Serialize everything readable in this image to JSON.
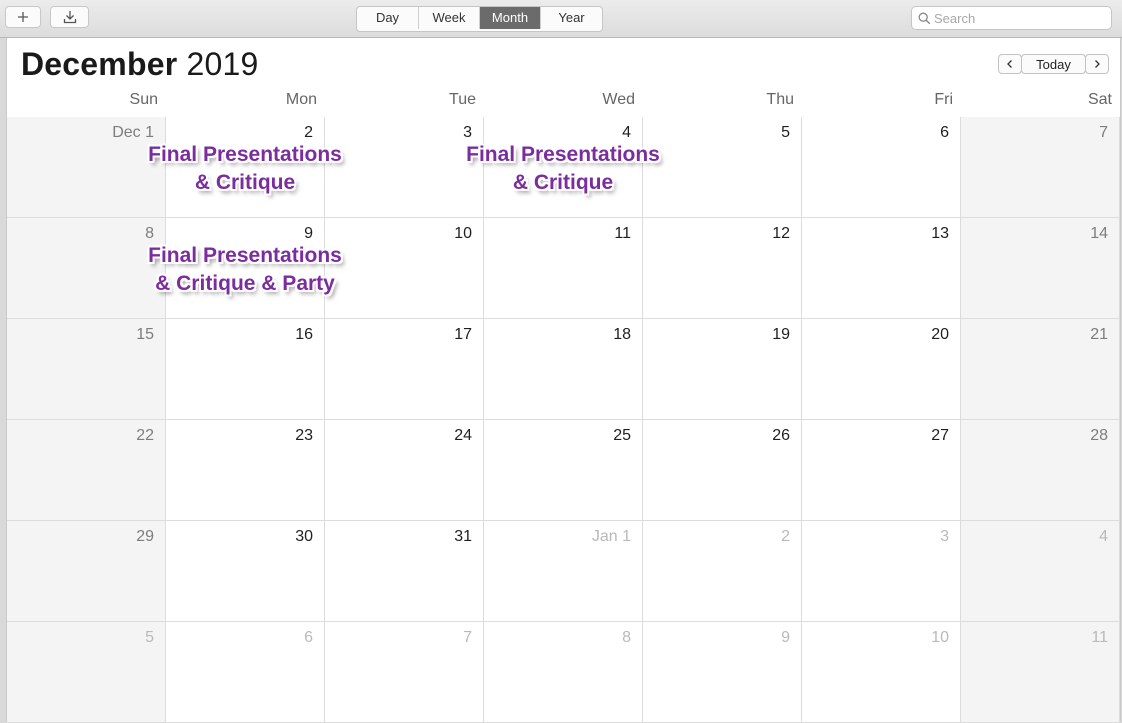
{
  "toolbar": {
    "add_icon": "plus-icon",
    "import_icon": "download-tray-icon",
    "views": [
      {
        "label": "Day",
        "active": false
      },
      {
        "label": "Week",
        "active": false
      },
      {
        "label": "Month",
        "active": true
      },
      {
        "label": "Year",
        "active": false
      }
    ],
    "search": {
      "placeholder": "Search",
      "icon": "search-icon"
    }
  },
  "header": {
    "month": "December",
    "year": "2019",
    "prev_icon": "chevron-left-icon",
    "today_label": "Today",
    "next_icon": "chevron-right-icon"
  },
  "weekdays": [
    "Sun",
    "Mon",
    "Tue",
    "Wed",
    "Thu",
    "Fri",
    "Sat"
  ],
  "weeks": [
    [
      "Dec 1",
      "2",
      "3",
      "4",
      "5",
      "6",
      "7"
    ],
    [
      "8",
      "9",
      "10",
      "11",
      "12",
      "13",
      "14"
    ],
    [
      "15",
      "16",
      "17",
      "18",
      "19",
      "20",
      "21"
    ],
    [
      "22",
      "23",
      "24",
      "25",
      "26",
      "27",
      "28"
    ],
    [
      "29",
      "30",
      "31",
      "Jan 1",
      "2",
      "3",
      "4"
    ],
    [
      "5",
      "6",
      "7",
      "8",
      "9",
      "10",
      "11"
    ]
  ],
  "other_month_cells": [
    [
      4,
      3
    ],
    [
      4,
      4
    ],
    [
      4,
      5
    ],
    [
      4,
      6
    ],
    [
      5,
      0
    ],
    [
      5,
      1
    ],
    [
      5,
      2
    ],
    [
      5,
      3
    ],
    [
      5,
      4
    ],
    [
      5,
      5
    ],
    [
      5,
      6
    ]
  ],
  "events": [
    {
      "week": 0,
      "day": 1,
      "lines": [
        "Final Presentations",
        "& Critique"
      ]
    },
    {
      "week": 0,
      "day": 3,
      "lines": [
        "Final Presentations",
        "& Critique"
      ]
    },
    {
      "week": 1,
      "day": 1,
      "lines": [
        "Final Presentations",
        "& Critique & Party"
      ]
    }
  ],
  "colors": {
    "event_text": "#7b2d9e",
    "active_view": "#6b6b6b"
  }
}
